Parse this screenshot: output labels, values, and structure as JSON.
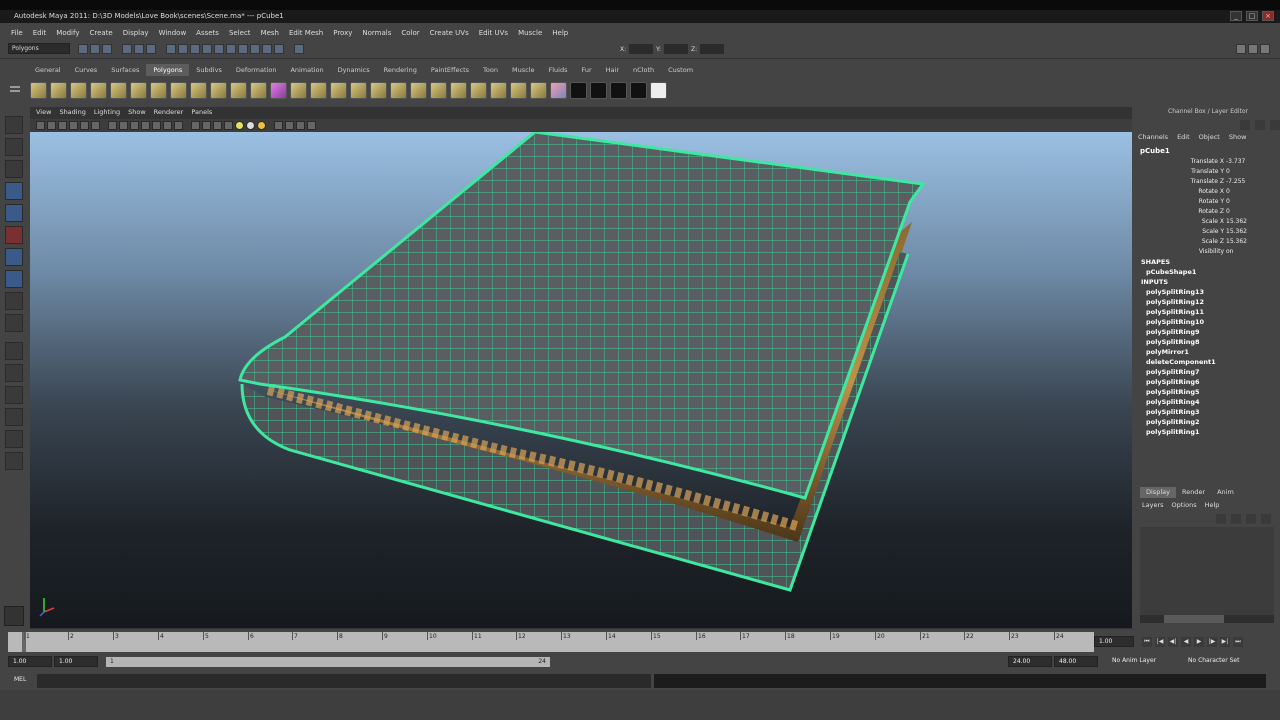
{
  "window": {
    "title": "Autodesk Maya 2011: D:\\3D Models\\Love Book\\scenes\\Scene.ma*   ---   pCube1"
  },
  "menubar": [
    "File",
    "Edit",
    "Modify",
    "Create",
    "Display",
    "Window",
    "Assets",
    "Select",
    "Mesh",
    "Edit Mesh",
    "Proxy",
    "Normals",
    "Color",
    "Create UVs",
    "Edit UVs",
    "Muscle",
    "Help"
  ],
  "status": {
    "mode": "Polygons",
    "x_label": "X:",
    "y_label": "Y:",
    "z_label": "Z:"
  },
  "shelf_tabs": [
    "General",
    "Curves",
    "Surfaces",
    "Polygons",
    "Subdivs",
    "Deformation",
    "Animation",
    "Dynamics",
    "Rendering",
    "PaintEffects",
    "Toon",
    "Muscle",
    "Fluids",
    "Fur",
    "Hair",
    "nCloth",
    "Custom"
  ],
  "shelf_active": "Polygons",
  "panel_menu": [
    "View",
    "Shading",
    "Lighting",
    "Show",
    "Renderer",
    "Panels"
  ],
  "channel_box": {
    "header": "Channel Box / Layer Editor",
    "menu": [
      "Channels",
      "Edit",
      "Object",
      "Show"
    ],
    "object": "pCube1",
    "attributes": [
      {
        "name": "Translate X",
        "value": "-3.737"
      },
      {
        "name": "Translate Y",
        "value": "0"
      },
      {
        "name": "Translate Z",
        "value": "-7.255"
      },
      {
        "name": "Rotate X",
        "value": "0"
      },
      {
        "name": "Rotate Y",
        "value": "0"
      },
      {
        "name": "Rotate Z",
        "value": "0"
      },
      {
        "name": "Scale X",
        "value": "15.362"
      },
      {
        "name": "Scale Y",
        "value": "15.362"
      },
      {
        "name": "Scale Z",
        "value": "15.362"
      },
      {
        "name": "Visibility",
        "value": "on"
      }
    ],
    "shapes_label": "SHAPES",
    "shape": "pCubeShape1",
    "inputs_label": "INPUTS",
    "inputs": [
      "polySplitRing13",
      "polySplitRing12",
      "polySplitRing11",
      "polySplitRing10",
      "polySplitRing9",
      "polySplitRing8",
      "polyMirror1",
      "deleteComponent1",
      "polySplitRing7",
      "polySplitRing6",
      "polySplitRing5",
      "polySplitRing4",
      "polySplitRing3",
      "polySplitRing2",
      "polySplitRing1"
    ]
  },
  "layer_editor": {
    "tabs": [
      "Display",
      "Render",
      "Anim"
    ],
    "active": "Display",
    "menu": [
      "Layers",
      "Options",
      "Help"
    ]
  },
  "timeline": {
    "ticks": [
      "1",
      "2",
      "3",
      "4",
      "5",
      "6",
      "7",
      "8",
      "9",
      "10",
      "11",
      "12",
      "13",
      "14",
      "15",
      "16",
      "17",
      "18",
      "19",
      "20",
      "21",
      "22",
      "23",
      "24"
    ],
    "current_frame": "1.00"
  },
  "range": {
    "start": "1.00",
    "start2": "1.00",
    "slider_start": "1",
    "slider_end": "24",
    "end": "24.00",
    "end2": "48.00",
    "anim_layer": "No Anim Layer",
    "char_set": "No Character Set"
  },
  "cmdline": {
    "label": "MEL"
  }
}
